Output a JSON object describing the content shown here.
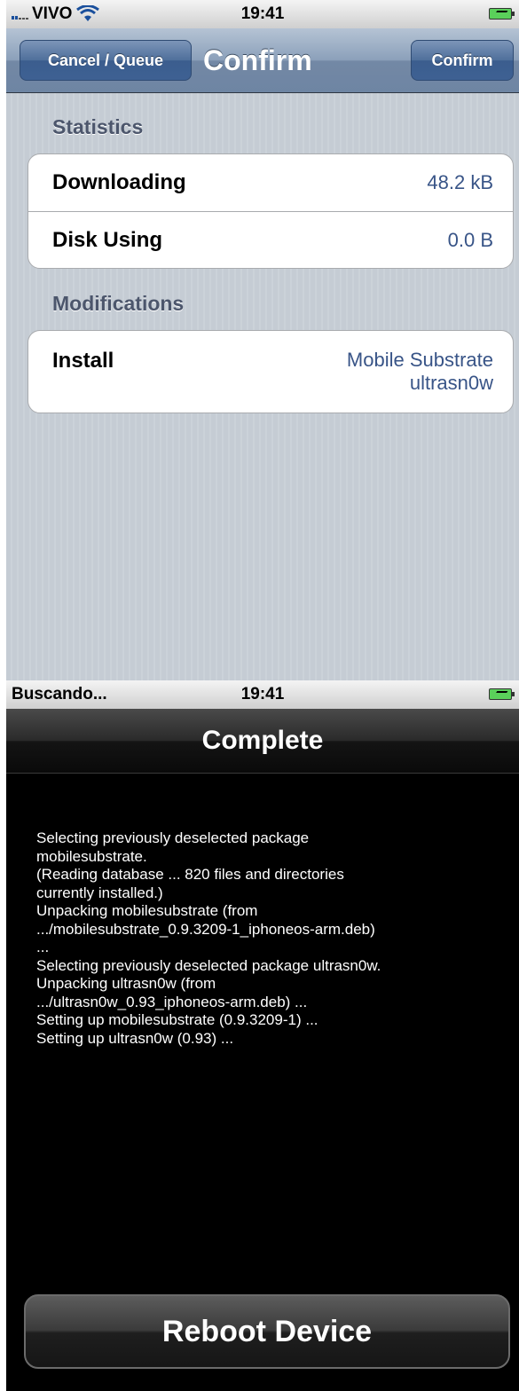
{
  "screen1": {
    "status": {
      "carrier": "VIVO",
      "time": "19:41"
    },
    "nav": {
      "cancel_label": "Cancel / Queue",
      "title": "Confirm",
      "confirm_label": "Confirm"
    },
    "statistics": {
      "header": "Statistics",
      "rows": [
        {
          "label": "Downloading",
          "value": "48.2 kB"
        },
        {
          "label": "Disk Using",
          "value": "0.0 B"
        }
      ]
    },
    "modifications": {
      "header": "Modifications",
      "rows": [
        {
          "label": "Install",
          "values": [
            "Mobile Substrate",
            "ultrasn0w"
          ]
        }
      ]
    }
  },
  "screen2": {
    "status": {
      "carrier": "Buscando...",
      "time": "19:41"
    },
    "nav": {
      "title": "Complete"
    },
    "log": [
      "Selecting previously deselected package",
      "mobilesubstrate.",
      "(Reading database ... 820 files and directories",
      "currently installed.)",
      "Unpacking mobilesubstrate (from",
      ".../mobilesubstrate_0.9.3209-1_iphoneos-arm.deb)",
      "...",
      "Selecting previously deselected package ultrasn0w.",
      "Unpacking ultrasn0w (from",
      ".../ultrasn0w_0.93_iphoneos-arm.deb) ...",
      "Setting up mobilesubstrate (0.9.3209-1) ...",
      "Setting up ultrasn0w (0.93) ..."
    ],
    "reboot_label": "Reboot Device"
  },
  "icons": [
    "signal-bars-icon",
    "wifi-icon",
    "battery-charging-icon"
  ]
}
